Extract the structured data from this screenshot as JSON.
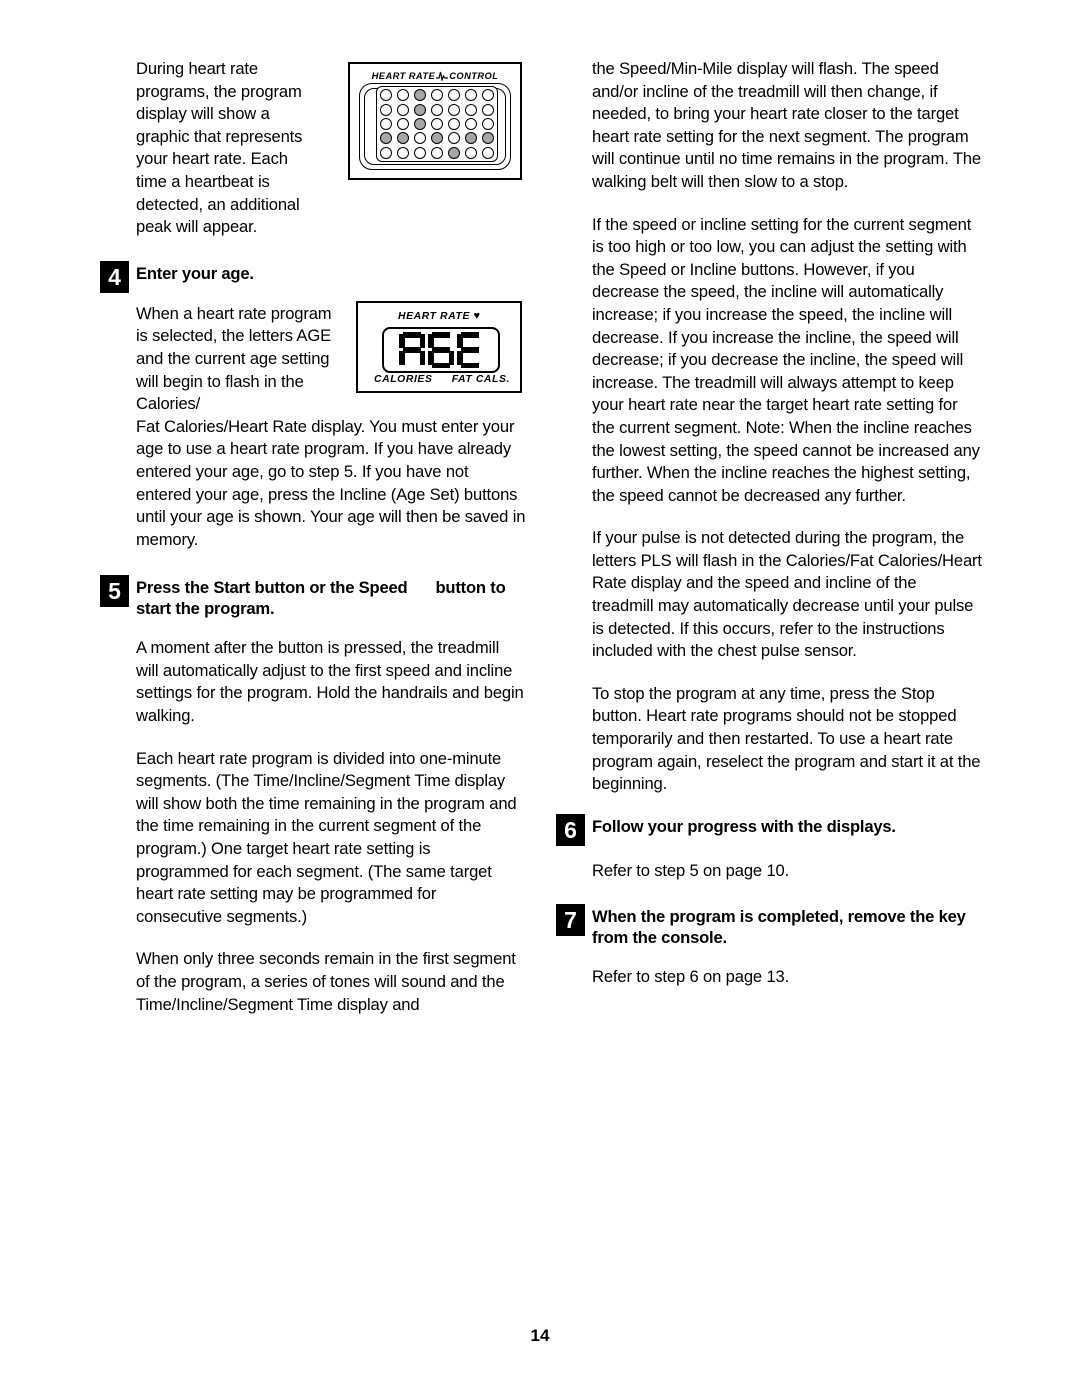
{
  "page": {
    "number": "14"
  },
  "left_column": {
    "intro_paragraph": "During heart rate programs, the program display will show a graphic that represents your heart rate. Each time a heartbeat is detected, an additional peak will appear.",
    "step4": {
      "number": "4",
      "title": "Enter your age.",
      "paragraph_wrap": "When a heart rate program is selected, the letters AGE and the current age setting will begin to flash in the Calories/",
      "paragraph_continue": "Fat Calories/Heart Rate display. You must enter your age to use a heart rate program. If you have already entered your age, go to step 5. If you have not entered your age, press the Incline (Age Set) buttons until your age is shown. Your age will then be saved in memory."
    },
    "step5": {
      "number": "5",
      "title_part1": "Press the Start button or the Speed",
      "title_part2": "button to start the program.",
      "paragraph_1": "A moment after the button is pressed, the treadmill will automatically adjust to the first speed and incline settings for the program. Hold the handrails and begin walking.",
      "paragraph_2": "Each heart rate program is divided into one-minute segments. (The Time/Incline/Segment Time display will show both the time remaining in the program and the time remaining in the current segment of the program.) One target heart rate setting is programmed for each segment. (The same target heart rate setting may be programmed for consecutive segments.)",
      "paragraph_3": "When only three seconds remain in the first segment of the program, a series of tones will sound and the Time/Incline/Segment Time display and"
    }
  },
  "right_column": {
    "paragraph_1": "the Speed/Min-Mile display will flash. The speed and/or incline of the treadmill will then change, if needed, to bring your heart rate closer to the target heart rate setting for the next segment. The program will continue until no time remains in the program. The walking belt will then slow to a stop.",
    "paragraph_2": "If the speed or incline setting for the current segment is too high or too low, you can adjust the setting with the Speed or Incline buttons. However, if you decrease the speed, the incline will automatically increase; if you increase the speed, the incline will decrease. If you increase the incline, the speed will decrease; if you decrease the incline, the speed will increase. The treadmill will always attempt to keep your heart rate near the target heart rate setting for the current segment. Note: When the incline reaches the lowest setting, the speed cannot be increased any further. When the incline reaches the highest setting, the speed cannot be decreased any further.",
    "paragraph_3": "If your pulse is not detected during the program, the letters PLS will flash in the Calories/Fat Calories/Heart Rate display and the speed and incline of the treadmill may automatically decrease until your pulse is detected. If this occurs, refer to the instructions included with the chest pulse sensor.",
    "paragraph_4": "To stop the program at any time, press the Stop button. Heart rate programs should not be stopped temporarily and then restarted. To use a heart rate program again, reselect the program and start it at the beginning.",
    "step6": {
      "number": "6",
      "title": "Follow your progress with the displays.",
      "paragraph": "Refer to step 5 on page 10."
    },
    "step7": {
      "number": "7",
      "title": "When the program is completed, remove the key from the console.",
      "paragraph": "Refer to step 6 on page 13."
    }
  },
  "figures": {
    "heart_rate_control": {
      "label_left": "HEART RATE",
      "label_right": "CONTROL",
      "icon": "ekg-blip-icon",
      "grid": {
        "columns": 7,
        "rows": 5,
        "filled": [
          [
            0,
            0,
            1,
            0,
            0,
            0,
            0
          ],
          [
            0,
            0,
            1,
            0,
            0,
            0,
            0
          ],
          [
            0,
            0,
            1,
            0,
            0,
            0,
            0
          ],
          [
            1,
            1,
            0,
            1,
            0,
            1,
            1
          ],
          [
            0,
            0,
            0,
            0,
            1,
            0,
            0
          ]
        ],
        "fill_color": "#a6a6a6"
      }
    },
    "age_display": {
      "top_label": "HEART RATE",
      "top_icon": "heart-icon",
      "value": "AGE",
      "bottom_left_label": "CALORIES",
      "bottom_right_label": "FAT CALS."
    }
  }
}
